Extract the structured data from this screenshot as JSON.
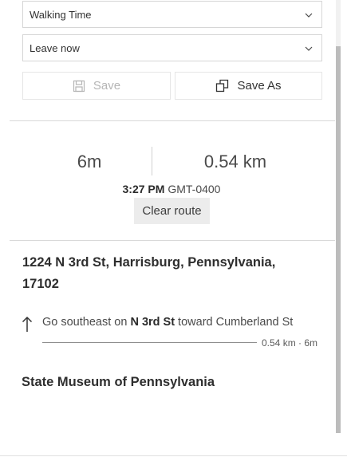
{
  "route_options": {
    "travel_mode": "Walking Time",
    "departure": "Leave now"
  },
  "actions": {
    "save_label": "Save",
    "save_as_label": "Save As"
  },
  "summary": {
    "duration": "6m",
    "distance": "0.54 km",
    "arrival_time": "3:27 PM",
    "timezone": "GMT-0400",
    "clear_label": "Clear route"
  },
  "directions": {
    "origin": "1224 N 3rd St, Harrisburg, Pennsylvania, 17102",
    "steps": [
      {
        "text_before": "Go southeast on ",
        "street": "N 3rd St",
        "text_after": " toward Cumberland St",
        "meta": "0.54 km · 6m",
        "icon": "arrow-up-icon"
      }
    ],
    "destination": "State Museum of Pennsylvania"
  },
  "colors": {
    "text": "#323232",
    "disabled": "#b5b5b5",
    "clear_bg": "#ececec"
  }
}
